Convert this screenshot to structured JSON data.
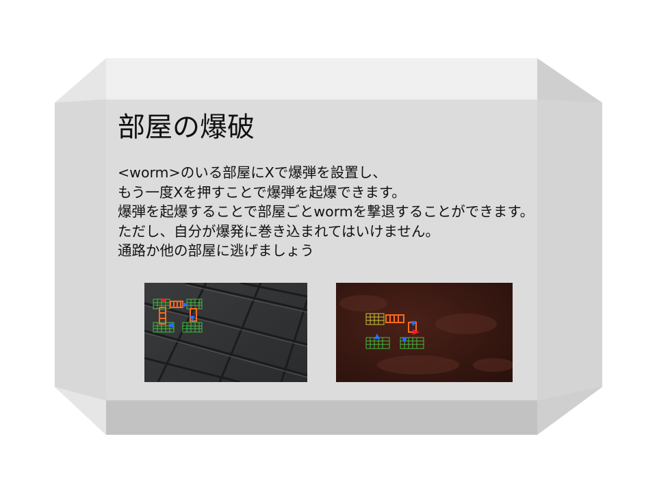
{
  "tutorial": {
    "title": "部屋の爆破",
    "lines": [
      "<worm>のいる部屋にXで爆弾を設置し、",
      "もう一度Xを押すことで爆弾を起爆できます。",
      "爆弾を起爆することで部屋ごとwormを撃退することができます。",
      "ただし、自分が爆発に巻き込まれてはいけません。",
      "通路か他の部屋に逃げましょう"
    ]
  },
  "colors": {
    "panel_face": "#dcdcdc",
    "panel_bevel_light": "#efefef",
    "panel_bevel_dark": "#c4c4c4",
    "room_grid_green": "#3fbf3f",
    "room_grid_yellow": "#c8c840",
    "bomb_orange": "#ff6a1a",
    "player_blue": "#2a6dff",
    "worm_red": "#ff1a2a"
  }
}
